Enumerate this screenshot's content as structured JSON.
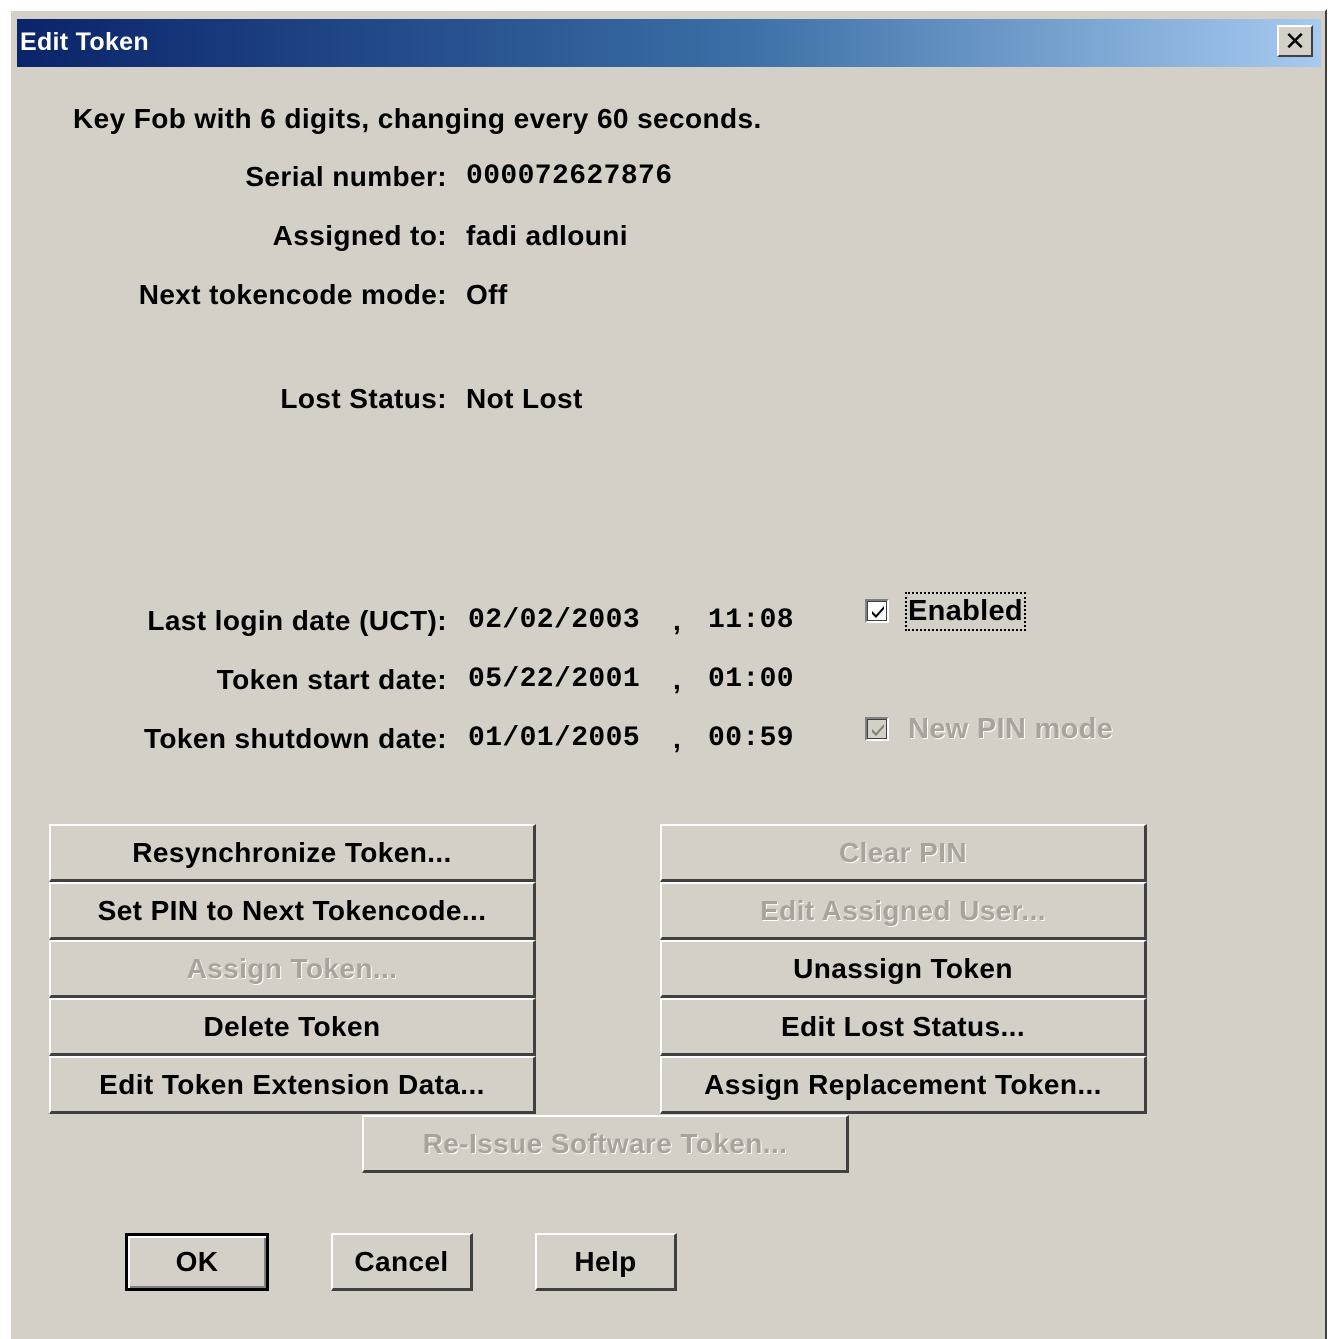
{
  "window": {
    "title": "Edit Token",
    "close_glyph": "✕"
  },
  "info": {
    "description": "Key Fob with 6 digits, changing every 60 seconds.",
    "serial_label": "Serial number:",
    "serial_value": "000072627876",
    "assigned_label": "Assigned to:",
    "assigned_value": "fadi adlouni",
    "next_mode_label": "Next tokencode mode:",
    "next_mode_value": "Off",
    "lost_label": "Lost Status:",
    "lost_value": "Not Lost"
  },
  "dates": {
    "last_login_label": "Last login date (UCT):",
    "last_login_date": "02/02/2003",
    "last_login_time": "11:08",
    "start_label": "Token start date:",
    "start_date": "05/22/2001",
    "start_time": "01:00",
    "shutdown_label": "Token shutdown date:",
    "shutdown_date": "01/01/2005",
    "shutdown_time": "00:59",
    "separator": ","
  },
  "options": {
    "enabled_label": "Enabled",
    "enabled_checked": true,
    "new_pin_label": "New PIN mode",
    "new_pin_checked": true
  },
  "buttons_left": {
    "resync": "Resynchronize Token...",
    "set_pin": "Set PIN to Next Tokencode...",
    "assign": "Assign Token...",
    "delete": "Delete Token",
    "edit_ext": "Edit Token Extension Data..."
  },
  "buttons_right": {
    "clear_pin": "Clear PIN",
    "edit_user": "Edit Assigned User...",
    "unassign": "Unassign Token",
    "edit_lost": "Edit Lost Status...",
    "assign_replacement": "Assign Replacement Token..."
  },
  "reissue": "Re-Issue Software Token...",
  "footer": {
    "ok": "OK",
    "cancel": "Cancel",
    "help": "Help"
  },
  "colors": {
    "dialog_bg": "#d4d0c8",
    "title_start": "#0a246a",
    "title_end": "#a6caf0",
    "disabled_text": "#a8a49c"
  }
}
